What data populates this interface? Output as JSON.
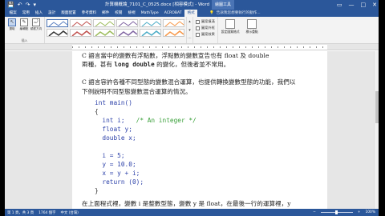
{
  "qat": {
    "save": "💾",
    "undo": "↶",
    "redo": "↷",
    "custom": "▾"
  },
  "title_bar": {
    "title": "計算機概論_7101_C_0525.docx [相容模式] - Word",
    "context_tab": "繪圖工具"
  },
  "window_controls": {
    "restore": "▭",
    "minimize": "—",
    "maximize": "□",
    "close": "✕"
  },
  "tabs": [
    "檔案",
    "常用",
    "插入",
    "設計",
    "版面配置",
    "參考資料",
    "郵件",
    "校閱",
    "檢視",
    "MathType",
    "ACROBAT",
    "格式"
  ],
  "active_tab": "格式",
  "tell_me": "告訴我您想要執行的動作...",
  "ribbon": {
    "insert_shapes": [
      {
        "label": "選取",
        "icon": "↖"
      },
      {
        "label": "編輯點",
        "icon": "✎"
      },
      {
        "label": "繞框方向",
        "icon": "⤾"
      }
    ],
    "side_buttons": [
      "圖案填滿",
      "圖案外框",
      "圖案效果"
    ],
    "big_buttons": [
      "設定圖案格式",
      "標示重點"
    ],
    "extra_button": "標示重點",
    "extra_button_hint": "標示重點",
    "group_names": [
      "插入",
      "圖案樣式"
    ]
  },
  "document": {
    "text_lines": [
      "C 語言當中的變數有浮點數，浮點數的變數宣告也有 float 及 double",
      "兩種，甚有 long double 的變化，但後者並不常用。",
      "C 語言容許各種不同型態的變數混合運算，也提供轉換變數型態的功能，我們以",
      "下例說明不同型態變數混合運算的情況。"
    ],
    "code": {
      "l1": "int main()",
      "l2": "{",
      "l3_a": "  int i;",
      "l3_b": "   /* An integer */",
      "l4": "  float y;",
      "l5": "  double x;",
      "l6": "  i = 5;",
      "l7": "  y = 10.0;",
      "l8": "  x = y + i;",
      "l9": "  return (0);",
      "l10": "}"
    },
    "bottom_line": "在上面程式裡，變數 i 是整數型態，變數 y 是 float，在最後一行的運算裡，y"
  },
  "status_bar": {
    "page": "第 1 頁，共 3 頁",
    "words": "1764 個字",
    "lang": "中文 (台灣)",
    "zoom": "100%"
  }
}
